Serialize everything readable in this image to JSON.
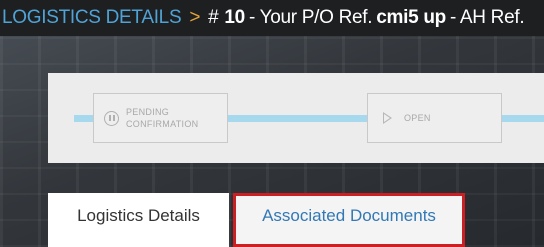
{
  "header": {
    "section": "LOGISTICS DETAILS",
    "separator": ">",
    "hash": "#",
    "order_number": "10",
    "po_label": "- Your P/O Ref.",
    "po_ref": "cmi5 up",
    "ah_label": "- AH Ref."
  },
  "progress": {
    "steps": [
      {
        "line1": "PENDING",
        "line2": "CONFIRMATION",
        "icon": "pause-circle-icon"
      },
      {
        "line1": "OPEN",
        "icon": "play-icon"
      }
    ],
    "track_color": "#a7d9ee"
  },
  "tabs": [
    {
      "label": "Logistics Details"
    },
    {
      "label": "Associated Documents",
      "highlight_color": "#cc1f24"
    }
  ],
  "colors": {
    "section_blue": "#4fa3d6",
    "separator_orange": "#e3a33a",
    "link_blue": "#3278b5"
  }
}
